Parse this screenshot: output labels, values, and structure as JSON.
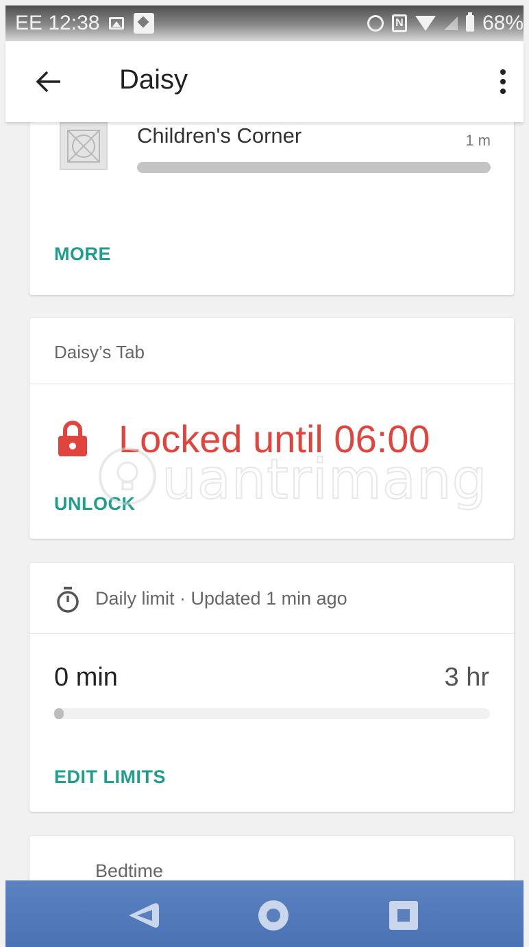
{
  "status_bar": {
    "carrier": "EE",
    "time": "12:38",
    "battery": "68%",
    "icons": [
      "image-icon",
      "picture-icon",
      "alarm-icon",
      "nfc-icon",
      "wifi-icon",
      "signal-icon",
      "battery-icon"
    ]
  },
  "app_bar": {
    "title": "Daisy",
    "back_icon": "arrow-back-icon",
    "menu_icon": "more-vert-icon"
  },
  "apps_card": {
    "app_name": "Children's Corner",
    "app_time": "1 m",
    "usage_fraction": 1.0,
    "more_label": "MORE"
  },
  "device_card": {
    "device_name": "Daisy’s Tab",
    "lock_status": "Locked until 06:00",
    "unlock_label": "UNLOCK",
    "status_color": "#e0443c"
  },
  "limit_card": {
    "header": "Daily limit · Updated 1 min ago",
    "used": "0 min",
    "limit": "3 hr",
    "used_fraction": 0.0,
    "edit_label": "EDIT LIMITS"
  },
  "bedtime_card": {
    "label": "Bedtime"
  },
  "watermark": {
    "text": "uantrimang"
  },
  "nav_bar": {
    "icons": [
      "back-nav-icon",
      "home-nav-icon",
      "recents-nav-icon"
    ]
  },
  "colors": {
    "accent": "#1f9e8e",
    "locked": "#e0443c",
    "nav_bar": "#4a72b4"
  }
}
